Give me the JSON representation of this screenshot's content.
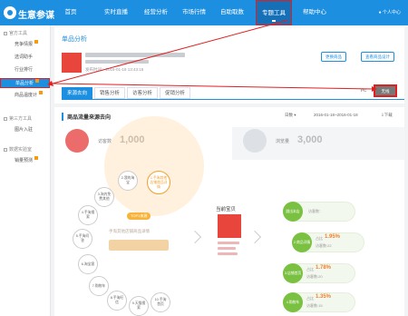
{
  "app": {
    "name": "生意参谋"
  },
  "nav": {
    "items": [
      {
        "label": "首页"
      },
      {
        "label": "实时直播"
      },
      {
        "label": "经营分析"
      },
      {
        "label": "市场行情"
      },
      {
        "label": "自助取数"
      },
      {
        "label": "专题工具"
      },
      {
        "label": "帮助中心"
      }
    ],
    "user_label": "个人中心"
  },
  "sidebar": {
    "sections": [
      {
        "title": "官方工具",
        "items": [
          {
            "label": "竞争情报",
            "flag": true
          },
          {
            "label": "选词助手"
          },
          {
            "label": "行业排行"
          },
          {
            "label": "单品分析",
            "flag": true
          },
          {
            "label": "商品温度计",
            "flag": true
          }
        ]
      },
      {
        "title": "第三方工具",
        "items": [
          {
            "label": "图片入驻"
          }
        ]
      },
      {
        "title": "数据实验室",
        "items": [
          {
            "label": "销量预测",
            "flag": true
          }
        ]
      }
    ]
  },
  "page": {
    "title": "单品分析",
    "meta": "发布时间：2016-01-18 13:43:15",
    "btn_change": "更换商品",
    "btn_settings": "查看商品设计",
    "tabs": [
      {
        "label": "来源去向"
      },
      {
        "label": "销售分析"
      },
      {
        "label": "访客分析"
      },
      {
        "label": "促销分析"
      }
    ],
    "device": "PC",
    "switch_btn": "无线"
  },
  "traffic": {
    "title": "商品流量来源去向",
    "filter_period": "日数",
    "filter_range": "2016-01-18~2016-01-18",
    "download": "下载",
    "visitors_label": "访客数",
    "visitors_value": "1,000",
    "views_label": "浏览量",
    "views_value": "3,000"
  },
  "flow": {
    "top_tag": "TOP1来源",
    "hero_label": "手淘其他店铺商品详情",
    "current_title": "当前宝贝",
    "sources": [
      {
        "label": "2.我的淘宝"
      },
      {
        "label": "1.手淘其他店铺商品详情"
      },
      {
        "label": "3.淘内免费其他"
      },
      {
        "label": "4.手淘搜索"
      },
      {
        "label": "5.手淘问答"
      },
      {
        "label": "6.淘宝客"
      },
      {
        "label": "7.购物车"
      },
      {
        "label": "8.手淘旺信"
      },
      {
        "label": "9.天猫搜索"
      },
      {
        "label": "10.手淘首页"
      }
    ],
    "destinations": [
      {
        "label": "跳出本店",
        "pct": "",
        "pct_label": "",
        "count": "访客数："
      },
      {
        "label": "2.商品详情",
        "pct": "1.95%",
        "pct_label": "占比",
        "count": "访客数:22"
      },
      {
        "label": "3.店铺首页",
        "pct": "1.78%",
        "pct_label": "占比",
        "count": "访客数:20"
      },
      {
        "label": "4.购物车",
        "pct": "1.35%",
        "pct_label": "占比",
        "count": "访客数:15"
      }
    ]
  },
  "colors": {
    "brand": "#1d8fe0",
    "highlight": "#e02020",
    "accent": "#f0a030",
    "green": "#7ac142"
  }
}
